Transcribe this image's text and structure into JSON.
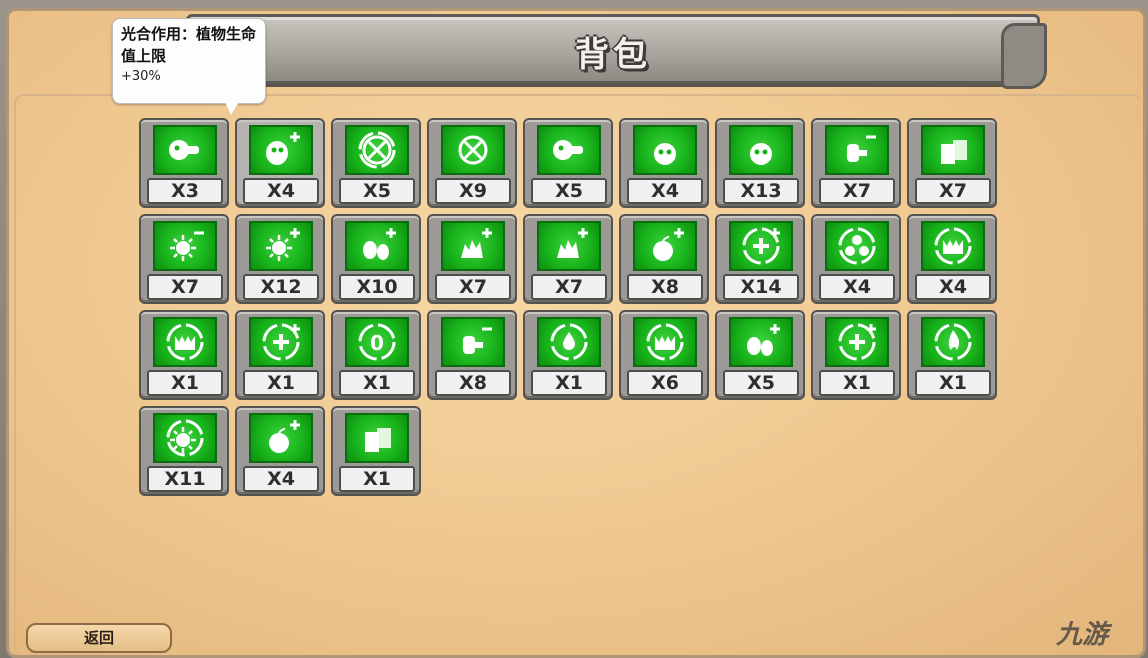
{
  "header": {
    "title": "背包"
  },
  "tooltip": {
    "title": "光合作用：植物生命值上限",
    "value": "+30%"
  },
  "footer": {
    "back_label": "返回"
  },
  "watermark": "九游",
  "inventory": [
    {
      "icon": "seed-spiral-icon",
      "count": "X3"
    },
    {
      "icon": "pea-plus-icon",
      "count": "X4"
    },
    {
      "icon": "crosshair-ring-icon",
      "count": "X5"
    },
    {
      "icon": "target-x-icon",
      "count": "X9"
    },
    {
      "icon": "peashooter-icon",
      "count": "X5"
    },
    {
      "icon": "zombie-head-icon",
      "count": "X4"
    },
    {
      "icon": "zombie-cone-icon",
      "count": "X13"
    },
    {
      "icon": "glove-minus-icon",
      "count": "X7"
    },
    {
      "icon": "cards-icon",
      "count": "X7"
    },
    {
      "icon": "sun-minus-icon",
      "count": "X7"
    },
    {
      "icon": "sun-plus-icon",
      "count": "X12"
    },
    {
      "icon": "berries-plus-icon",
      "count": "X10"
    },
    {
      "icon": "spiky-plus-icon",
      "count": "X7"
    },
    {
      "icon": "spiky-cactus-plus-icon",
      "count": "X7"
    },
    {
      "icon": "fruit-plus-icon",
      "count": "X8"
    },
    {
      "icon": "heal-plus-ring-icon",
      "count": "X14"
    },
    {
      "icon": "clover-ring-icon",
      "count": "X4"
    },
    {
      "icon": "jaws-ring-icon",
      "count": "X4"
    },
    {
      "icon": "jaws-ring-icon",
      "count": "X1"
    },
    {
      "icon": "plus-ring-icon",
      "count": "X1"
    },
    {
      "icon": "zero-ring-icon",
      "count": "X1"
    },
    {
      "icon": "hammer-minus-icon",
      "count": "X8"
    },
    {
      "icon": "drop-ring-icon",
      "count": "X1"
    },
    {
      "icon": "fire-jaws-ring-icon",
      "count": "X6"
    },
    {
      "icon": "eggs-plus-icon",
      "count": "X5"
    },
    {
      "icon": "double-plus-ring-icon",
      "count": "X1"
    },
    {
      "icon": "flame-ring-icon",
      "count": "X1"
    },
    {
      "icon": "sun-burst-ring-icon",
      "count": "X11"
    },
    {
      "icon": "apple-plus-icon",
      "count": "X4"
    },
    {
      "icon": "gift-tools-icon",
      "count": "X1"
    }
  ],
  "selected_index": 1
}
